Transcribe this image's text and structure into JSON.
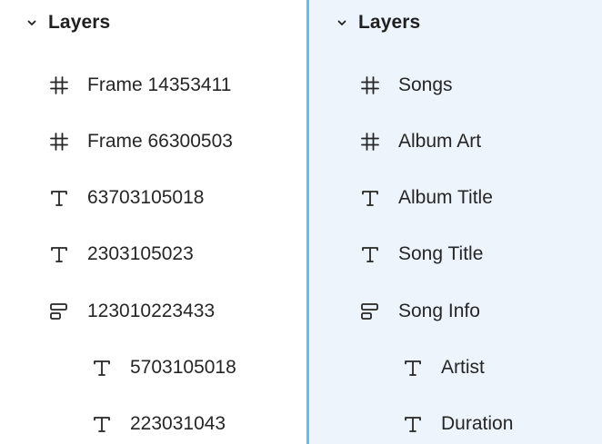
{
  "left_panel": {
    "header": {
      "icon": "chevron-down-icon",
      "label": "Layers"
    },
    "layers": [
      {
        "icon": "frame-icon",
        "label": "Frame 14353411"
      },
      {
        "icon": "frame-icon",
        "label": "Frame 66300503"
      },
      {
        "icon": "text-icon",
        "label": "63703105018"
      },
      {
        "icon": "text-icon",
        "label": "2303105023"
      },
      {
        "icon": "auto-layout-icon",
        "label": "123010223433"
      },
      {
        "icon": "text-icon",
        "label": "5703105018"
      },
      {
        "icon": "text-icon",
        "label": "223031043"
      }
    ]
  },
  "right_panel": {
    "header": {
      "icon": "chevron-down-icon",
      "label": "Layers"
    },
    "layers": [
      {
        "icon": "frame-icon",
        "label": "Songs"
      },
      {
        "icon": "frame-icon",
        "label": "Album Art"
      },
      {
        "icon": "text-icon",
        "label": "Album Title"
      },
      {
        "icon": "text-icon",
        "label": "Song Title"
      },
      {
        "icon": "auto-layout-icon",
        "label": "Song Info"
      },
      {
        "icon": "text-icon",
        "label": "Artist"
      },
      {
        "icon": "text-icon",
        "label": "Duration"
      }
    ]
  },
  "colors": {
    "divider": "#5bc2ea",
    "selected_panel_bg": "#edf4fc",
    "text": "#1f1f1f"
  }
}
